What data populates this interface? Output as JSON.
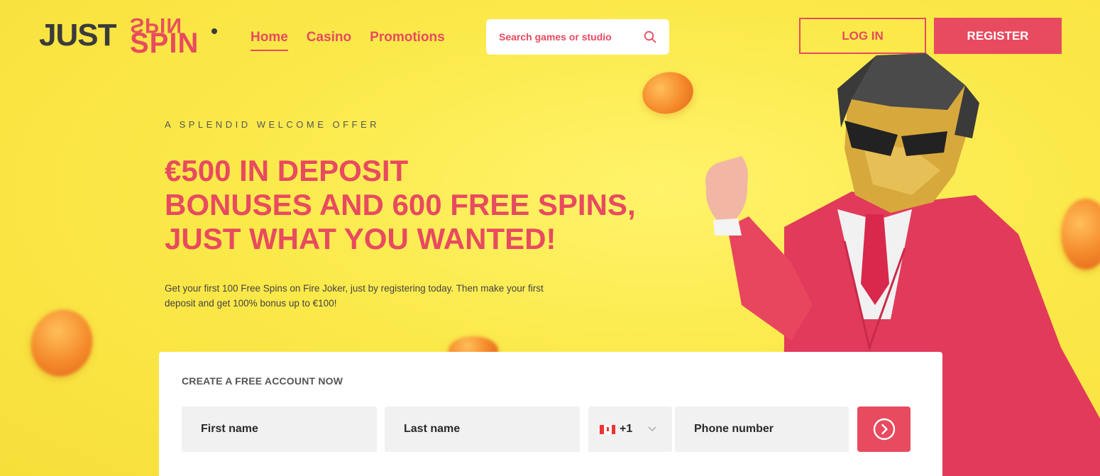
{
  "header": {
    "logo": {
      "word1": "JUST",
      "word2": "SPIN",
      "word2_flipped": "SPIN"
    },
    "nav": [
      {
        "label": "Home",
        "active": true
      },
      {
        "label": "Casino",
        "active": false
      },
      {
        "label": "Promotions",
        "active": false
      }
    ],
    "search": {
      "placeholder": "Search games or studio",
      "icon": "search-icon"
    },
    "login_label": "LOG IN",
    "register_label": "REGISTER"
  },
  "hero": {
    "eyebrow": "A SPLENDID WELCOME OFFER",
    "headline": [
      "€500 IN DEPOSIT",
      "BONUSES AND 600 FREE SPINS,",
      "JUST WHAT YOU WANTED!"
    ],
    "subtext": "Get your first 100 Free Spins on Fire Joker, just by registering today. Then make your first deposit and get 100% bonus up to €100!"
  },
  "form": {
    "title": "CREATE A FREE ACCOUNT NOW",
    "first_name_placeholder": "First name",
    "last_name_placeholder": "Last name",
    "country_code": "+1",
    "country_flag": "canada-flag-icon",
    "phone_placeholder": "Phone number",
    "submit_icon": "arrow-right-circle-icon"
  },
  "colors": {
    "brand": "#e84a5f",
    "background": "#fbe94a",
    "dark": "#3b3b3b"
  }
}
